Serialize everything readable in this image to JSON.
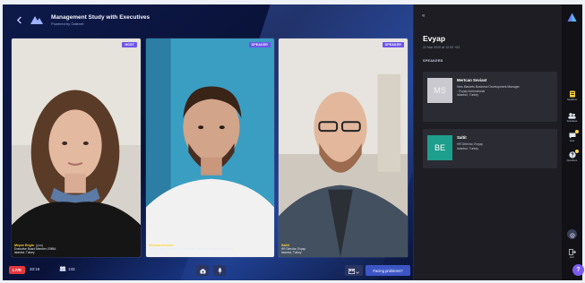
{
  "app": {
    "title": "Management Study with Executives",
    "subtitle": "Powered by Gatenet"
  },
  "participants": [
    {
      "role": "HOST",
      "name": "Meyve Engin",
      "tag": "(you)",
      "line1": "Executive Board Member, EMBA",
      "line2": "Istanbul, Turkey"
    },
    {
      "role": "SPEAKER",
      "name": "Mertcan Seviast",
      "tag": "",
      "line1": "New Markets Business Development Manager, Evyap International",
      "line2": "Istanbul, Turkey"
    },
    {
      "role": "SPEAKER",
      "name": "Saltit",
      "tag": "",
      "line1": "HR Director, Evyap",
      "line2": "Istanbul, Turkey"
    }
  ],
  "bottom_bar": {
    "live_label": "LIVE",
    "timer": "33:16",
    "viewer_count": "133",
    "problem_button": "Facing problems?"
  },
  "panel": {
    "collapse_glyph": "«",
    "event_title": "Evyap",
    "event_date": "22 Mar 2020 at 12:00 +03",
    "section_label": "SPEAKERS",
    "speakers": [
      {
        "initials": "MS",
        "name": "Mertcan Seviast",
        "line1": "New Markets Business Development Manager",
        "line2": "- Evyap International",
        "line3": "Istanbul, Turkey"
      },
      {
        "initials": "BE",
        "name": "Saltit",
        "line1": "HR Director, Evyap",
        "line2": "Istanbul, Turkey"
      }
    ]
  },
  "rail": {
    "items": [
      {
        "label": "Speakers",
        "icon": "speakers-icon"
      },
      {
        "label": "Attendees",
        "icon": "attendees-icon"
      },
      {
        "label": "Chat",
        "icon": "chat-icon"
      },
      {
        "label": "Questions",
        "icon": "questions-icon"
      }
    ],
    "exit_label": "Exit",
    "help_glyph": "?"
  },
  "colors": {
    "accent": "#6f55e8",
    "live": "#e8373e",
    "name_highlight": "#ffd23a",
    "panel_bg": "#1d1d23",
    "button": "#3c56c6"
  }
}
